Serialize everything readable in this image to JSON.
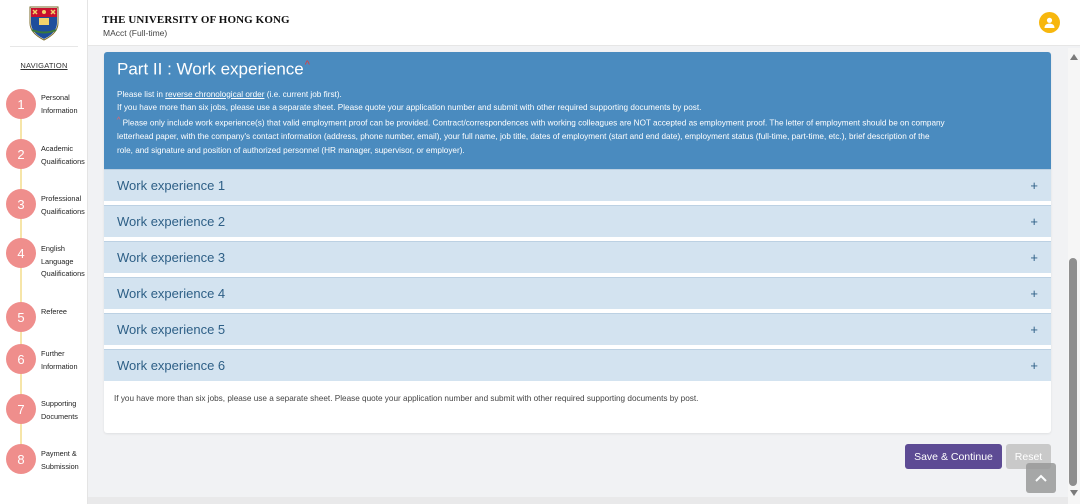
{
  "sidebar": {
    "nav_title": "NAVIGATION",
    "steps": [
      {
        "num": "1",
        "label": "Personal Information"
      },
      {
        "num": "2",
        "label": "Academic Qualifications"
      },
      {
        "num": "3",
        "label": "Professional Qualifications"
      },
      {
        "num": "4",
        "label": "English Language Qualifications"
      },
      {
        "num": "5",
        "label": "Referee"
      },
      {
        "num": "6",
        "label": "Further Information"
      },
      {
        "num": "7",
        "label": "Supporting Documents"
      },
      {
        "num": "8",
        "label": "Payment & Submission"
      }
    ]
  },
  "header": {
    "university": "THE UNIVERSITY OF HONG KONG",
    "program": "MAcct (Full-time)"
  },
  "section": {
    "title": "Part II : Work experience",
    "title_marker": "^",
    "line1_pre": "Please list in ",
    "line1_link": "reverse chronological order",
    "line1_post": " (i.e. current job first).",
    "line2": "If you have more than six jobs, please use a separate sheet. Please quote your application number and submit with other required supporting documents by post.",
    "note_marker": "^",
    "line3": " Please only include work experience(s) that valid employment proof can be provided. Contract/correspondences with working colleagues are NOT accepted as employment proof. The letter of employment should be on company",
    "line4": "letterhead paper, with the company's contact information (address, phone number, email), your full name, job title, dates of employment (start and end date), employment status (full-time, part-time, etc.), brief description of the",
    "line5": "role, and signature and position of authorized personnel (HR manager, supervisor, or employer)."
  },
  "accordion": [
    {
      "label": "Work experience 1",
      "icon": "+"
    },
    {
      "label": "Work experience 2",
      "icon": "+"
    },
    {
      "label": "Work experience 3",
      "icon": "+"
    },
    {
      "label": "Work experience 4",
      "icon": "+"
    },
    {
      "label": "Work experience 5",
      "icon": "+"
    },
    {
      "label": "Work experience 6",
      "icon": "+"
    }
  ],
  "footer_note": "If you have more than six jobs, please use a separate sheet. Please quote your application number and submit with other required supporting documents by post.",
  "buttons": {
    "save": "Save & Continue",
    "reset": "Reset"
  },
  "colors": {
    "section_header": "#4a8bbf",
    "accordion": "#d3e3f0",
    "step_circle": "#ef8e8c",
    "save_button": "#5d4b94",
    "avatar": "#f7b70e"
  }
}
